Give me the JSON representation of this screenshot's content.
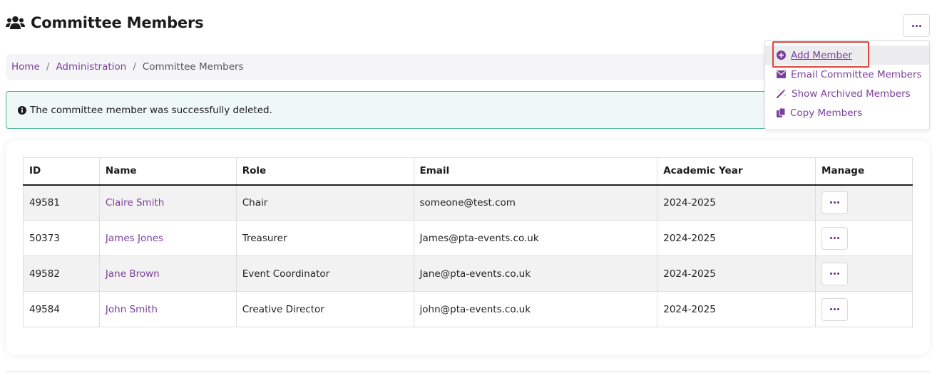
{
  "header": {
    "title": "Committee Members",
    "icon": "users-icon"
  },
  "breadcrumb": {
    "items": [
      {
        "label": "Home",
        "link": true
      },
      {
        "label": "Administration",
        "link": true
      },
      {
        "label": "Committee Members",
        "link": false
      }
    ]
  },
  "alert": {
    "icon": "info-circle-icon",
    "message": "The committee member was successfully deleted."
  },
  "table": {
    "columns": [
      "ID",
      "Name",
      "Role",
      "Email",
      "Academic Year",
      "Manage"
    ],
    "rows": [
      {
        "id": "49581",
        "name": "Claire Smith",
        "role": "Chair",
        "email": "someone@test.com",
        "year": "2024-2025"
      },
      {
        "id": "50373",
        "name": "James Jones",
        "role": "Treasurer",
        "email": "James@pta-events.co.uk",
        "year": "2024-2025"
      },
      {
        "id": "49582",
        "name": "Jane Brown",
        "role": "Event Coordinator",
        "email": "Jane@pta-events.co.uk",
        "year": "2024-2025"
      },
      {
        "id": "49584",
        "name": "John Smith",
        "role": "Creative Director",
        "email": "john@pta-events.co.uk",
        "year": "2024-2025"
      }
    ]
  },
  "dropdown": {
    "items": [
      {
        "label": "Add Member",
        "icon": "plus-circle-icon",
        "active": true
      },
      {
        "label": "Email Committee Members",
        "icon": "envelope-icon",
        "active": false
      },
      {
        "label": "Show Archived Members",
        "icon": "magic-wand-icon",
        "active": false
      },
      {
        "label": "Copy Members",
        "icon": "copy-icon",
        "active": false
      }
    ]
  },
  "colors": {
    "accent": "#7b3f9b",
    "alert_border": "#4ab39d",
    "alert_bg": "#eef8f6",
    "highlight": "#e0453f"
  }
}
